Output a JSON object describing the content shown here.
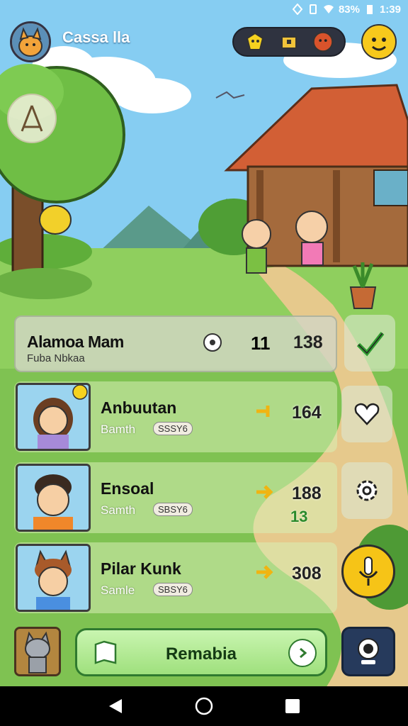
{
  "status_bar": {
    "battery": "83%",
    "time": "1:39"
  },
  "player": {
    "name": "Cassa lla"
  },
  "leaderboard": {
    "header": {
      "title": "Alamoa Mam",
      "subtitle": "Fuba Nbkaa",
      "pips": "11",
      "score": "138"
    },
    "rows": [
      {
        "name": "Anbuutan",
        "sub": "Bamth",
        "tag": "SSSY6",
        "score": "164",
        "bonus": ""
      },
      {
        "name": "Ensoal",
        "sub": "Samth",
        "tag": "SBSY6",
        "score": "188",
        "bonus": "13"
      },
      {
        "name": "Pilar Kunk",
        "sub": "Samle",
        "tag": "SBSY6",
        "score": "308",
        "bonus": ""
      }
    ]
  },
  "play_button": {
    "label": "Remabia"
  },
  "icons": {
    "currency": [
      "yellow-gem-icon",
      "chest-icon",
      "red-coin-icon"
    ],
    "header_gear": "gear-icon",
    "side_buttons": [
      "check-icon",
      "heart-icon",
      "settings-icon"
    ],
    "mic": "microphone-icon",
    "camera": "camera-icon"
  },
  "colors": {
    "accent_green": "#9fe07d",
    "accent_yellow": "#f6c417",
    "panel_dark": "#2f3340"
  }
}
